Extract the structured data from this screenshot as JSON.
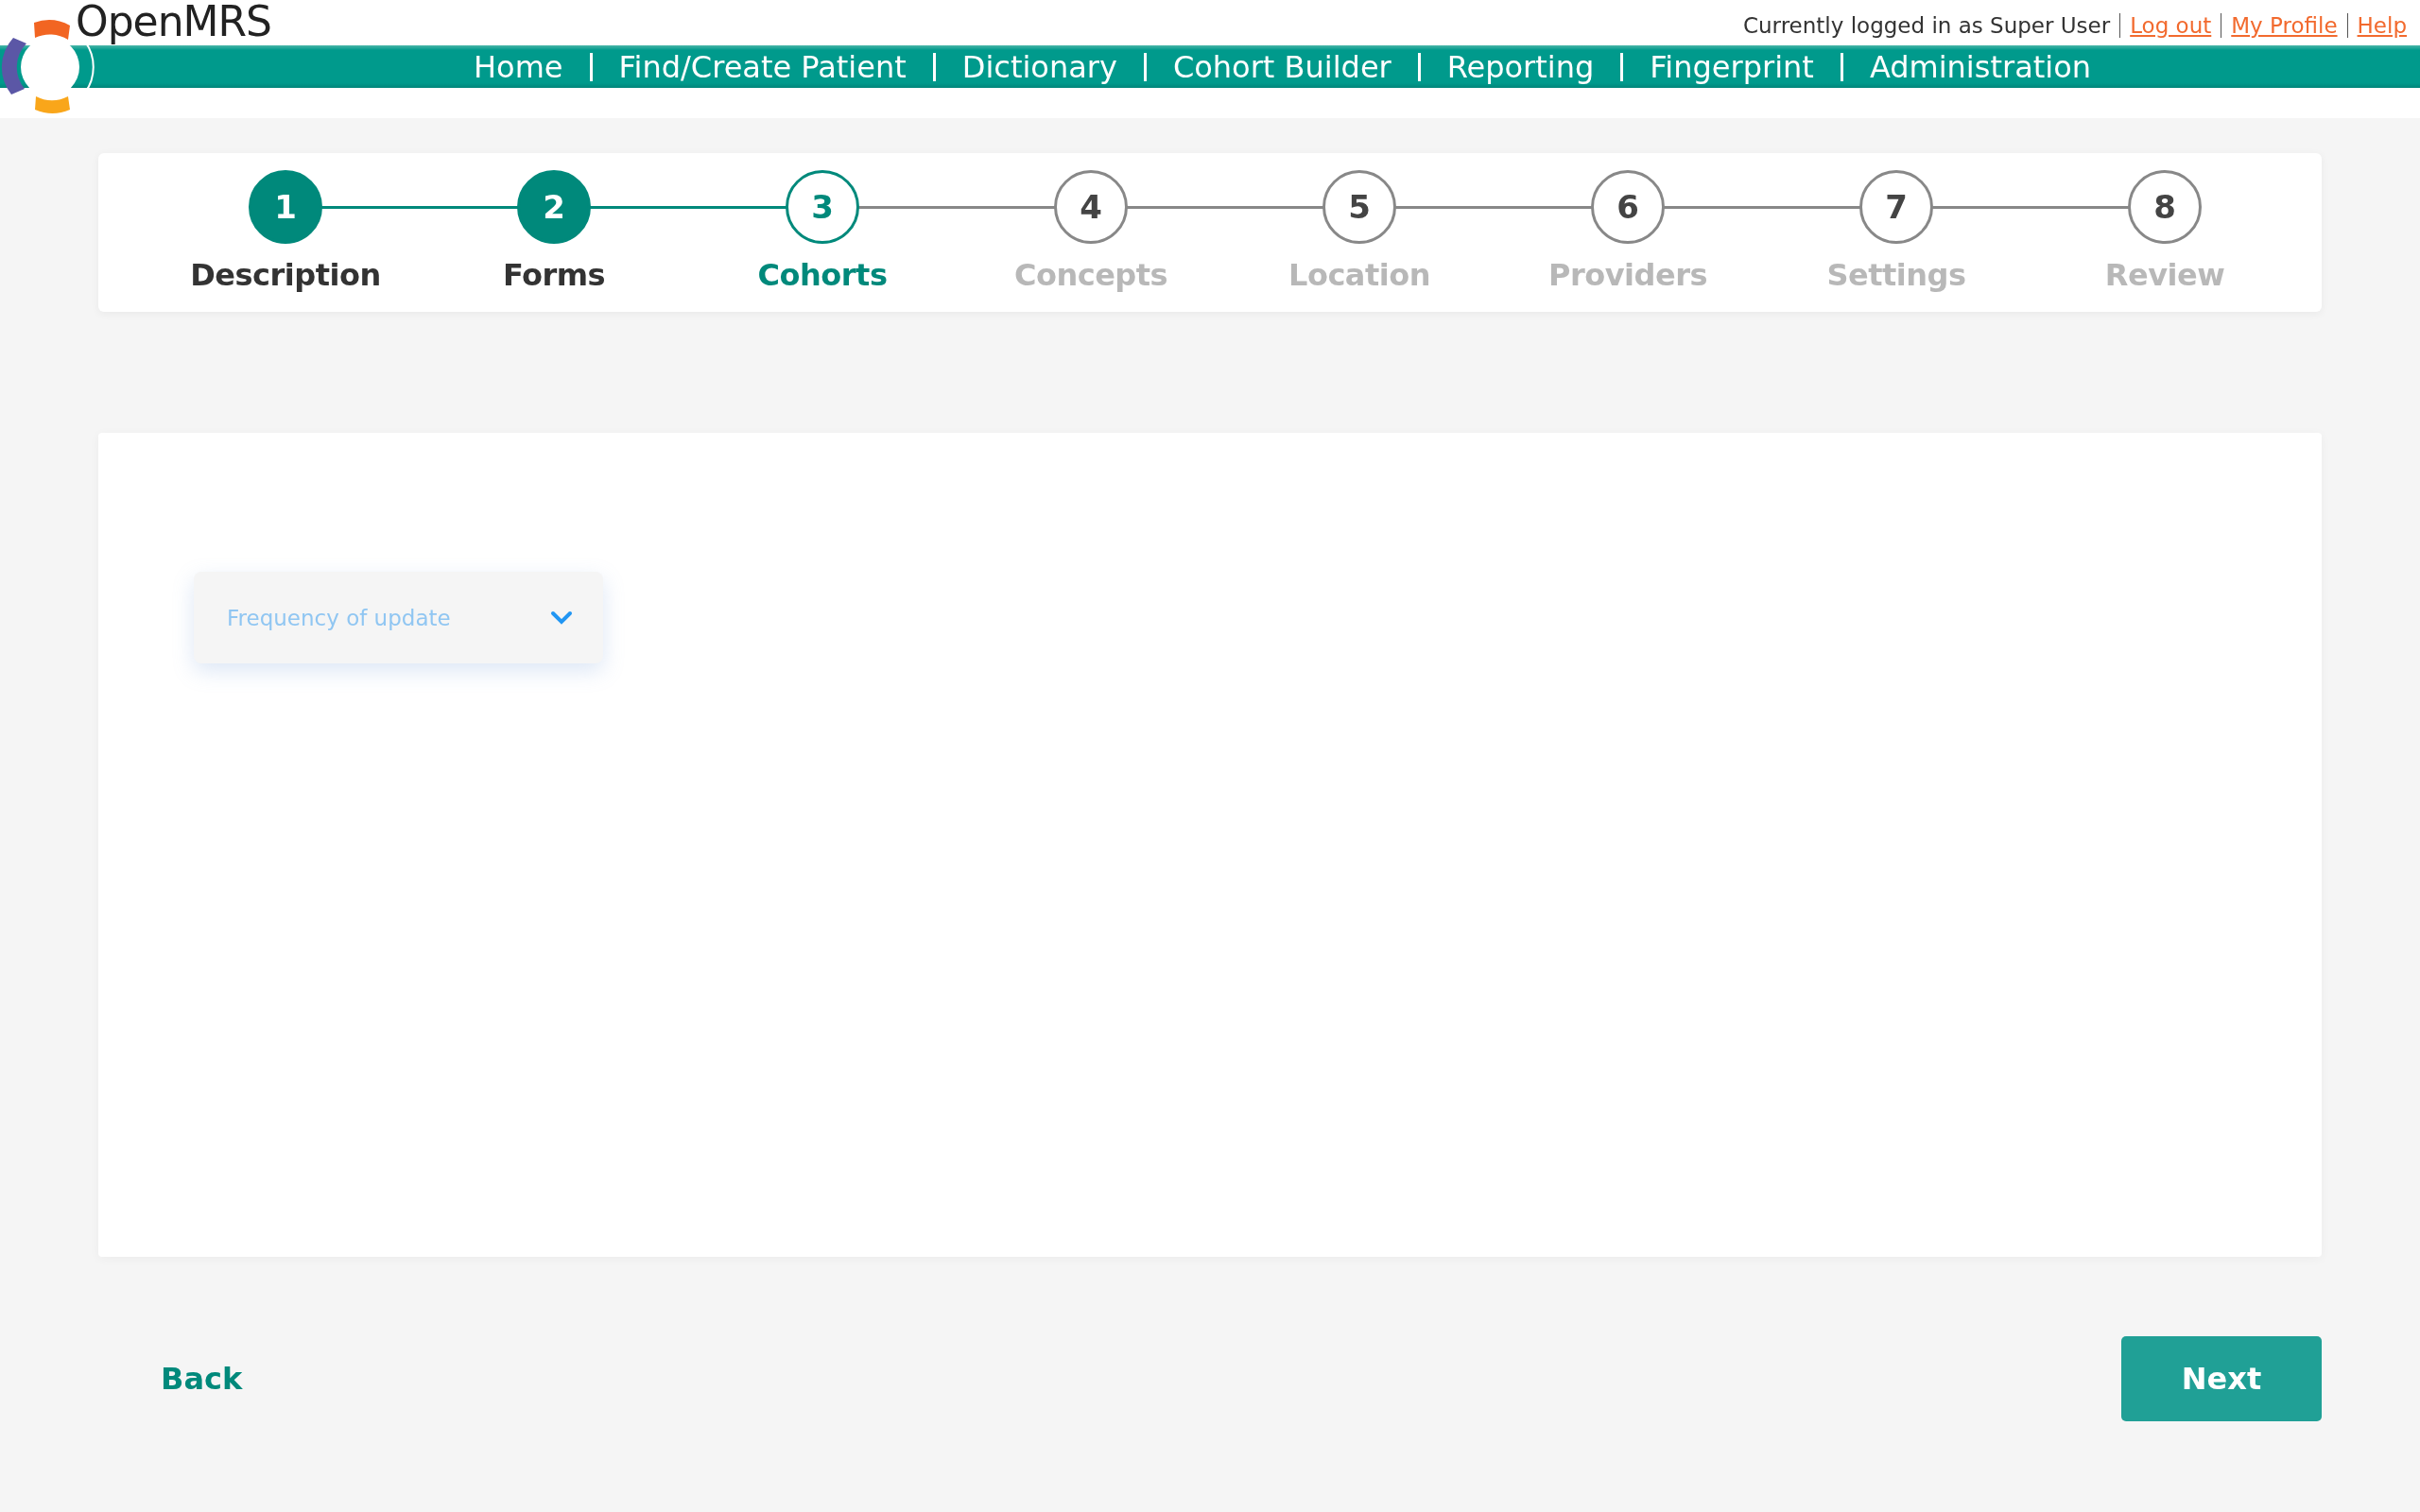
{
  "header": {
    "brand": "OpenMRS",
    "user_text": "Currently logged in as Super User",
    "user_links": [
      "Log out",
      "My Profile",
      "Help"
    ],
    "nav": [
      "Home",
      "Find/Create Patient",
      "Dictionary",
      "Cohort Builder",
      "Reporting",
      "Fingerprint",
      "Administration"
    ]
  },
  "stepper": {
    "steps": [
      {
        "number": "1",
        "label": "Description",
        "completed": true,
        "selected": false
      },
      {
        "number": "2",
        "label": "Forms",
        "completed": true,
        "selected": false
      },
      {
        "number": "3",
        "label": "Cohorts",
        "completed": false,
        "selected": true
      },
      {
        "number": "4",
        "label": "Concepts",
        "completed": false,
        "selected": false
      },
      {
        "number": "5",
        "label": "Location",
        "completed": false,
        "selected": false
      },
      {
        "number": "6",
        "label": "Providers",
        "completed": false,
        "selected": false
      },
      {
        "number": "7",
        "label": "Settings",
        "completed": false,
        "selected": false
      },
      {
        "number": "8",
        "label": "Review",
        "completed": false,
        "selected": false
      }
    ]
  },
  "frequency_select": {
    "placeholder": "Frequency of update"
  },
  "footer": {
    "back": "Back",
    "next": "Next"
  }
}
